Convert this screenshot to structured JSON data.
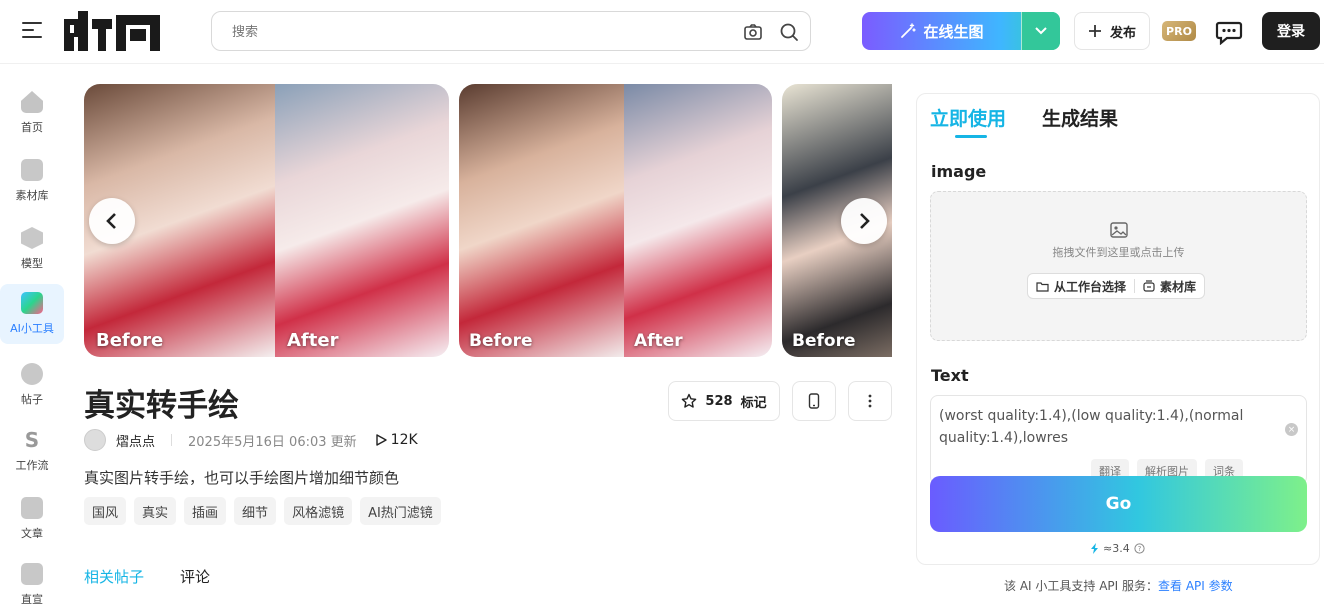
{
  "header": {
    "search_placeholder": "搜索",
    "generate_label": "在线生图",
    "publish_label": "发布",
    "pro_label": "PRO",
    "login_label": "登录"
  },
  "sidebar": {
    "items": [
      {
        "label": "首页"
      },
      {
        "label": "素材库"
      },
      {
        "label": "模型"
      },
      {
        "label": "AI小工具"
      },
      {
        "label": "帖子"
      },
      {
        "label": "工作流"
      },
      {
        "label": "文章"
      },
      {
        "label": "直宣"
      }
    ],
    "active_index": 3
  },
  "carousel": {
    "slides": [
      {
        "before": "Before",
        "after": "After"
      },
      {
        "before": "Before",
        "after": "After"
      },
      {
        "before": "Before"
      }
    ]
  },
  "tool": {
    "title": "真实转手绘",
    "favorite_count": "528",
    "favorite_label": "标记",
    "author": "熠点点",
    "updated": "2025年5月16日 06:03 更新",
    "views": "12K",
    "description": "真实图片转手绘，也可以手绘图片增加细节颜色",
    "tags": [
      "国风",
      "真实",
      "插画",
      "细节",
      "风格滤镜",
      "AI热门滤镜"
    ]
  },
  "bottom_tabs": {
    "related": "相关帖子",
    "comments": "评论"
  },
  "panel": {
    "tab_use": "立即使用",
    "tab_results": "生成结果",
    "image_label": "image",
    "upload_hint": "拖拽文件到这里或点击上传",
    "from_workspace": "从工作台选择",
    "library": "素材库",
    "text_label": "Text",
    "text_value": "(worst quality:1.4),(low quality:1.4),(normal quality:1.4),lowres",
    "tool_translate": "翻译",
    "tool_parse": "解析图片",
    "tool_extra": "词条",
    "go_label": "Go",
    "cost": "≈3.4",
    "api_note": "该 AI 小工具支持 API 服务：",
    "api_link": "查看 API 参数"
  },
  "colors": {
    "accent": "#16b5e5",
    "link": "#2a7fff",
    "login_bg": "#1f1f1f"
  }
}
